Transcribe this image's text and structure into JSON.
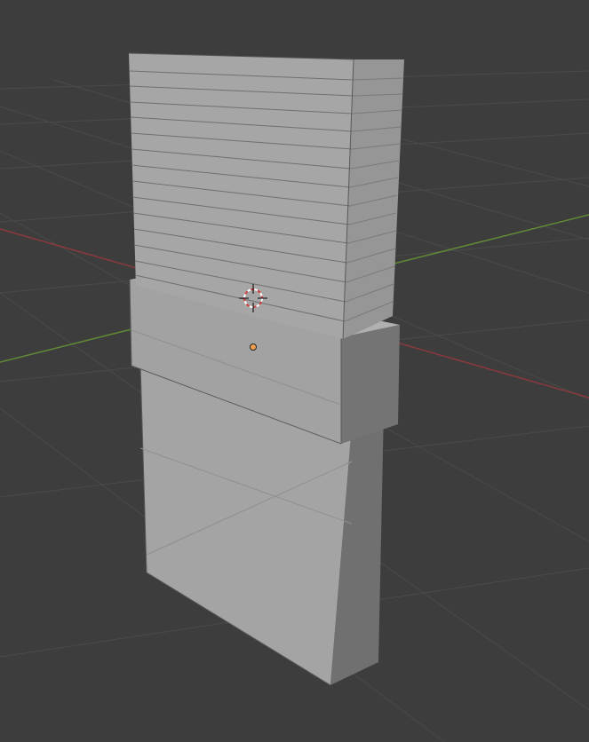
{
  "viewport": {
    "name": "3d-viewport",
    "background_color": "#3d3d3d",
    "grid_color": "#4a4a4a",
    "x_axis_color": "#8a3a3f",
    "y_axis_color": "#5f8a35",
    "mesh_face_light": "#a5a5a5",
    "mesh_face_mid": "#9a9a9a",
    "mesh_face_dark": "#6f6f6f",
    "mesh_edge_color": "#5a5a5a",
    "origin_color": "#f0a050",
    "cursor_icon": "3d-cursor-icon",
    "origin_icon": "object-origin-icon"
  },
  "objects": [
    {
      "name": "stack-slab-block"
    },
    {
      "name": "middle-collar-block"
    },
    {
      "name": "lower-tall-block"
    }
  ]
}
